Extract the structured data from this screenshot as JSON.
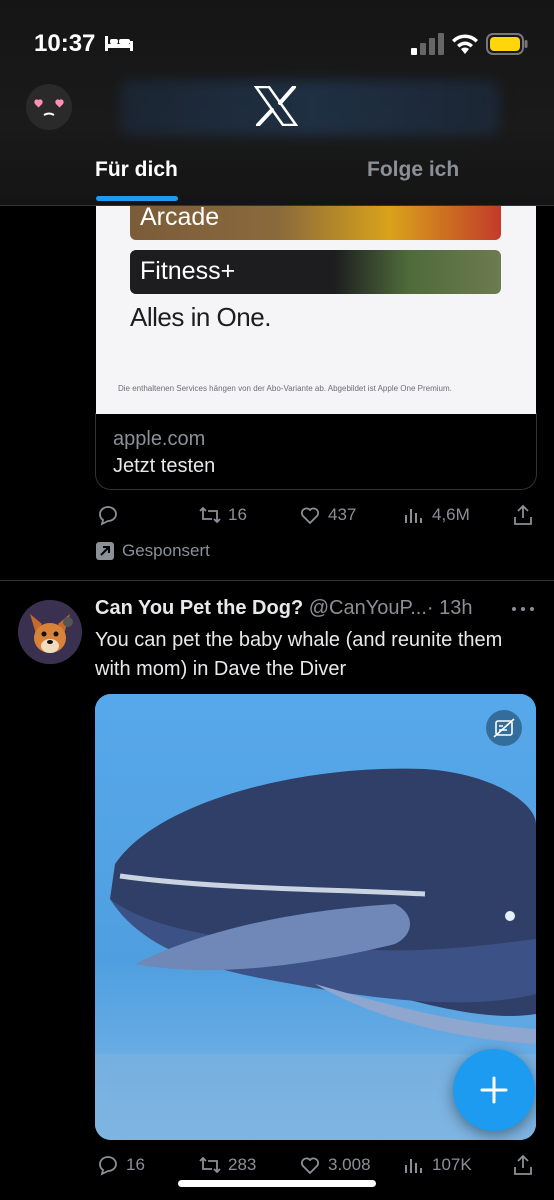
{
  "status_bar": {
    "time": "10:37"
  },
  "header": {
    "tabs": [
      {
        "label": "Für dich",
        "active": true
      },
      {
        "label": "Folge ich",
        "active": false
      }
    ]
  },
  "ad": {
    "rows": [
      "Arcade",
      "Fitness+"
    ],
    "tagline_pre": "Alles in ",
    "tagline_post": "One.",
    "fineprint": "Die enthaltenen Services hängen von der Abo-Variante ab. Abgebildet ist Apple One Premium.",
    "domain": "apple.com",
    "cta": "Jetzt testen",
    "actions": {
      "retweets": "16",
      "likes": "437",
      "views": "4,6M"
    },
    "sponsored_label": "Gesponsert"
  },
  "tweet": {
    "author_name": "Can You Pet the Dog?",
    "author_handle": "@CanYouP...",
    "time": "· 13h",
    "text": "You can pet the baby whale (and reunite them with mom) in Dave the Diver",
    "actions": {
      "replies": "16",
      "retweets": "283",
      "likes": "3.008",
      "views": "107K"
    }
  },
  "colors": {
    "accent": "#1d9bf0",
    "background": "#000000",
    "secondary_text": "#8b9096"
  },
  "icons": [
    "bed-icon",
    "signal-icon",
    "wifi-icon",
    "battery-icon",
    "x-logo",
    "reply-icon",
    "retweet-icon",
    "like-icon",
    "views-icon",
    "share-icon",
    "more-icon",
    "cc-icon",
    "plus-icon"
  ]
}
